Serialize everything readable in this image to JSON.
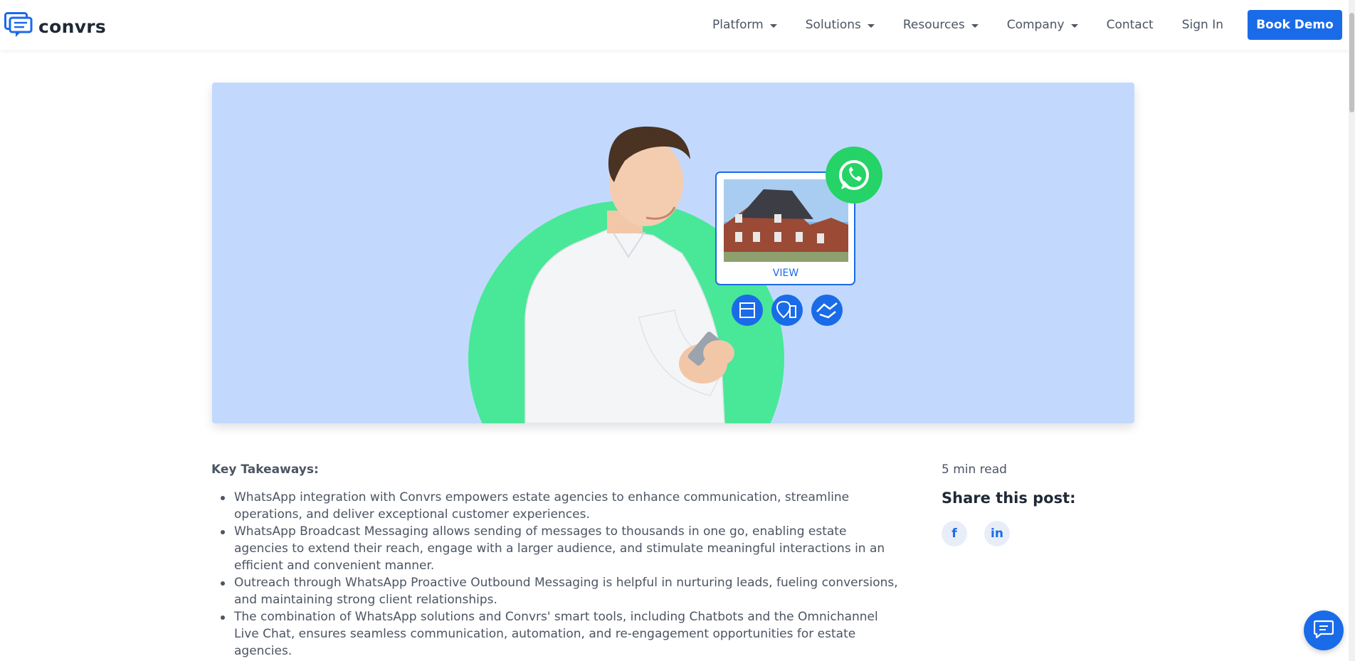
{
  "nav": {
    "logo_text": "convrs",
    "items": [
      {
        "label": "Platform",
        "dropdown": true
      },
      {
        "label": "Solutions",
        "dropdown": true
      },
      {
        "label": "Resources",
        "dropdown": true
      },
      {
        "label": "Company",
        "dropdown": true
      },
      {
        "label": "Contact",
        "dropdown": false
      },
      {
        "label": "Sign In",
        "dropdown": false
      }
    ],
    "cta_label": "Book Demo"
  },
  "hero": {
    "card_button_label": "VIEW",
    "icons": [
      "whatsapp-icon",
      "building-icon",
      "map-pin-icon",
      "handshake-icon"
    ]
  },
  "article": {
    "key_takeaways_title": "Key Takeaways:",
    "takeaways": [
      "WhatsApp integration with Convrs empowers estate agencies to enhance communication, streamline operations, and deliver exceptional customer experiences.",
      "WhatsApp Broadcast Messaging allows sending of messages to thousands in one go, enabling estate agencies to extend their reach, engage with a larger audience, and stimulate meaningful interactions in an efficient and convenient manner.",
      "Outreach through WhatsApp Proactive Outbound Messaging is helpful in nurturing leads, fueling conversions, and maintaining strong client relationships.",
      "The combination of WhatsApp solutions and Convrs' smart tools, including Chatbots and the Omnichannel Live Chat, ensures seamless communication, automation, and re-engagement opportunities for estate agencies."
    ]
  },
  "sidebar": {
    "read_time": "5 min read",
    "share_title": "Share this post:",
    "share_facebook": "f",
    "share_linkedin": "in"
  },
  "colors": {
    "brand_blue": "#1a6be8",
    "hero_bg": "#c2d9fd",
    "circle_green": "#48e898",
    "whatsapp_green": "#25d366"
  }
}
